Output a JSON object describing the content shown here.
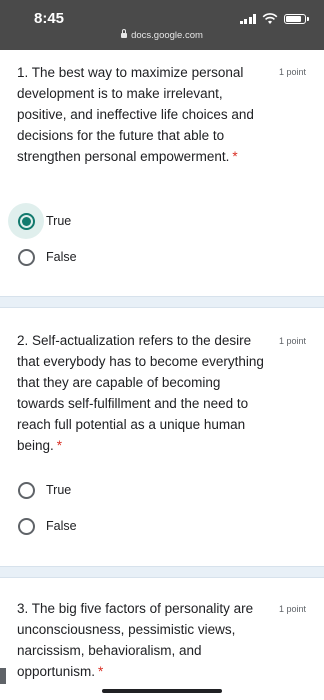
{
  "status_bar": {
    "time": "8:45",
    "url": "docs.google.com"
  },
  "questions": [
    {
      "text": "1. The best way to maximize personal development is to make irrelevant, positive, and ineffective life choices and decisions for the future that able to strengthen personal empowerment.",
      "required": "*",
      "points": "1 point",
      "options": [
        {
          "label": "True",
          "checked": true
        },
        {
          "label": "False",
          "checked": false
        }
      ]
    },
    {
      "text": "2. Self-actualization refers to the desire that everybody has to become everything that they are capable of becoming towards self-fulfillment and the need to reach full potential as a unique human being.",
      "required": "*",
      "points": "1 point",
      "options": [
        {
          "label": "True",
          "checked": false
        },
        {
          "label": "False",
          "checked": false
        }
      ]
    },
    {
      "text": "3. The big five factors of personality are unconsciousness, pessimistic views, narcissism, behavioralism, and opportunism.",
      "required": "*",
      "points": "1 point",
      "options": []
    }
  ],
  "colors": {
    "accent": "#137a6e",
    "required": "#d93025",
    "divider": "#e8f0f7",
    "status_bar": "#4a4a4a"
  }
}
